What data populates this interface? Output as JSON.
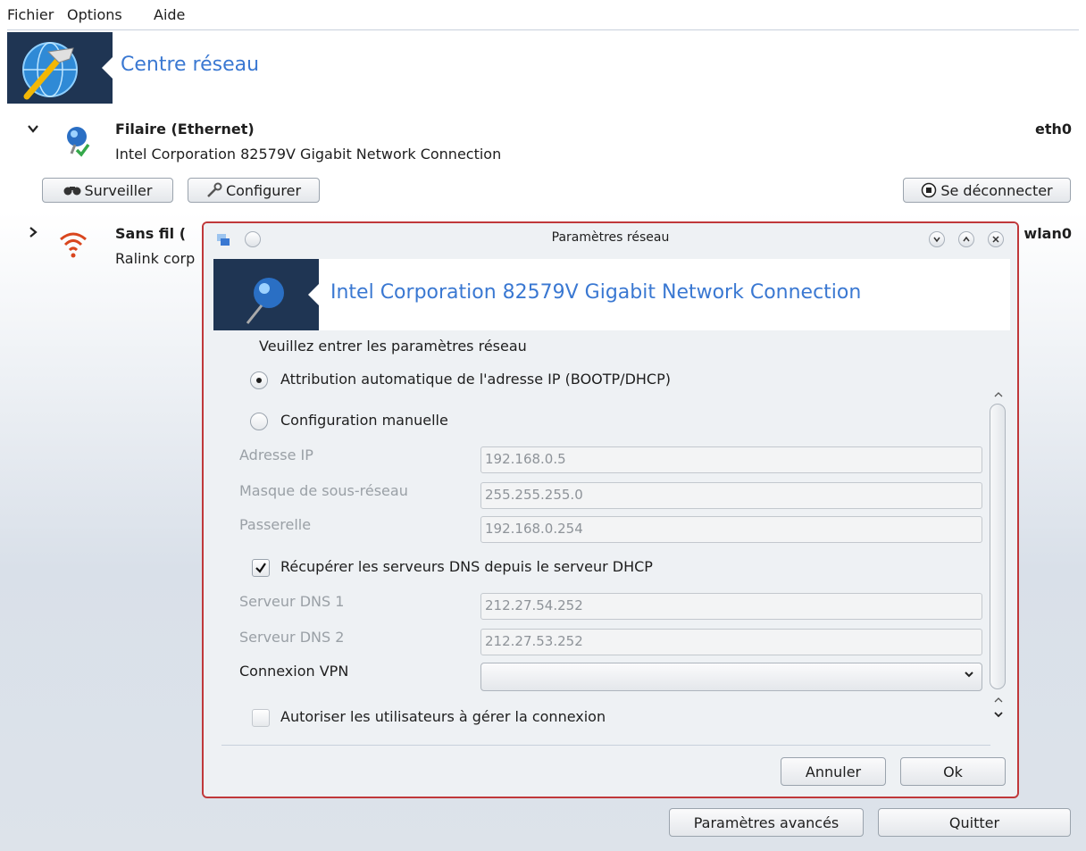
{
  "menu": {
    "file": "Fichier",
    "options": "Options",
    "help": "Aide"
  },
  "app": {
    "title": "Centre réseau"
  },
  "connections": [
    {
      "title": "Filaire (Ethernet)",
      "description": "Intel Corporation 82579V Gigabit Network Connection",
      "interface": "eth0",
      "expanded": true,
      "actions": {
        "monitor": "Surveiller",
        "configure": "Configurer",
        "disconnect": "Se déconnecter"
      }
    },
    {
      "title": "Sans fil (",
      "description": "Ralink corp",
      "interface": "wlan0",
      "expanded": false
    }
  ],
  "footer": {
    "advanced": "Paramètres avancés",
    "quit": "Quitter"
  },
  "dialog": {
    "window_title": "Paramètres réseau",
    "banner_title": "Intel Corporation 82579V Gigabit Network Connection",
    "prompt": "Veuillez entrer les paramètres réseau",
    "radio_auto": "Attribution automatique de l'adresse IP (BOOTP/DHCP)",
    "radio_manual": "Configuration manuelle",
    "selected_mode": "auto",
    "ip_label": "Adresse IP",
    "ip_value": "192.168.0.5",
    "netmask_label": "Masque de sous-réseau",
    "netmask_value": "255.255.255.0",
    "gateway_label": "Passerelle",
    "gateway_value": "192.168.0.254",
    "dns_from_dhcp_label": "Récupérer les serveurs DNS depuis le serveur DHCP",
    "dns_from_dhcp_checked": true,
    "dns1_label": "Serveur DNS 1",
    "dns1_value": "212.27.54.252",
    "dns2_label": "Serveur DNS 2",
    "dns2_value": "212.27.53.252",
    "vpn_label": "Connexion VPN",
    "vpn_value": "",
    "allow_users_label": "Autoriser les utilisateurs à gérer la connexion",
    "allow_users_checked": false,
    "cancel": "Annuler",
    "ok": "Ok"
  },
  "colors": {
    "accent": "#3a78d2",
    "dialog_border": "#c0383a",
    "banner_bg": "#1f3553",
    "wifi": "#d9461e"
  }
}
